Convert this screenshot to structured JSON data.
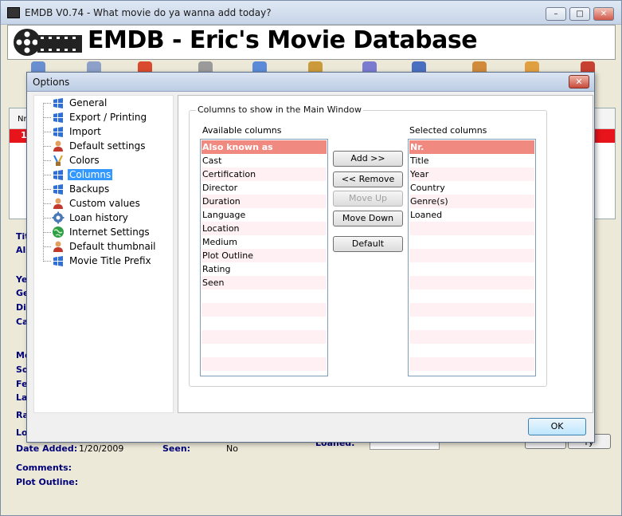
{
  "app": {
    "window_title": "EMDB V0.74 - What movie do ya wanna add today?",
    "banner_title": "EMDB - Eric's Movie Database",
    "min_label": "–",
    "max_label": "□",
    "close_label": "✕"
  },
  "background": {
    "list_header": "Nr",
    "list_row_number": "1",
    "labels": [
      "Tit",
      "Als",
      "Ye",
      "Ge",
      "Dir",
      "Ca",
      "Me",
      "So",
      "Fe",
      "La",
      "Ra",
      "Lo"
    ],
    "date_added_label": "Date Added:",
    "date_added_value": "1/20/2009",
    "seen_label": "Seen:",
    "seen_value": "No",
    "comments_label": "Comments:",
    "plot_outline_label": "Plot Outline:",
    "loaned_label": "Loaned:",
    "right_button_label": "ry"
  },
  "dialog": {
    "title": "Options",
    "close_label": "✕",
    "ok_label": "OK",
    "tree": [
      {
        "label": "General",
        "icon": "windows-flag-icon"
      },
      {
        "label": "Export / Printing",
        "icon": "windows-flag-icon"
      },
      {
        "label": "Import",
        "icon": "windows-flag-icon"
      },
      {
        "label": "Default settings",
        "icon": "user-icon"
      },
      {
        "label": "Colors",
        "icon": "paint-brushes-icon"
      },
      {
        "label": "Columns",
        "icon": "windows-flag-icon",
        "selected": true
      },
      {
        "label": "Backups",
        "icon": "windows-flag-icon"
      },
      {
        "label": "Custom values",
        "icon": "user-icon"
      },
      {
        "label": "Loan history",
        "icon": "gear-icon"
      },
      {
        "label": "Internet Settings",
        "icon": "globe-icon"
      },
      {
        "label": "Default thumbnail",
        "icon": "user-icon"
      },
      {
        "label": "Movie Title Prefix",
        "icon": "windows-flag-icon"
      }
    ],
    "columns": {
      "group_title": "Columns to show in the Main Window",
      "available_label": "Available columns",
      "selected_label": "Selected columns",
      "available": [
        "Also known as",
        "Cast",
        "Certification",
        "Director",
        "Duration",
        "Language",
        "Location",
        "Medium",
        "Plot Outline",
        "Rating",
        "Seen"
      ],
      "selected": [
        "Nr.",
        "Title",
        "Year",
        "Country",
        "Genre(s)",
        "Loaned"
      ],
      "buttons": {
        "add": "Add >>",
        "remove": "<< Remove",
        "move_up": "Move Up",
        "move_down": "Move Down",
        "default": "Default"
      }
    }
  },
  "colors": {
    "selection_row": "#f08a80",
    "alt_row": "#fff0f3",
    "list_red": "#e8141b",
    "label_blue": "#00007a",
    "tree_select": "#3399ff"
  }
}
